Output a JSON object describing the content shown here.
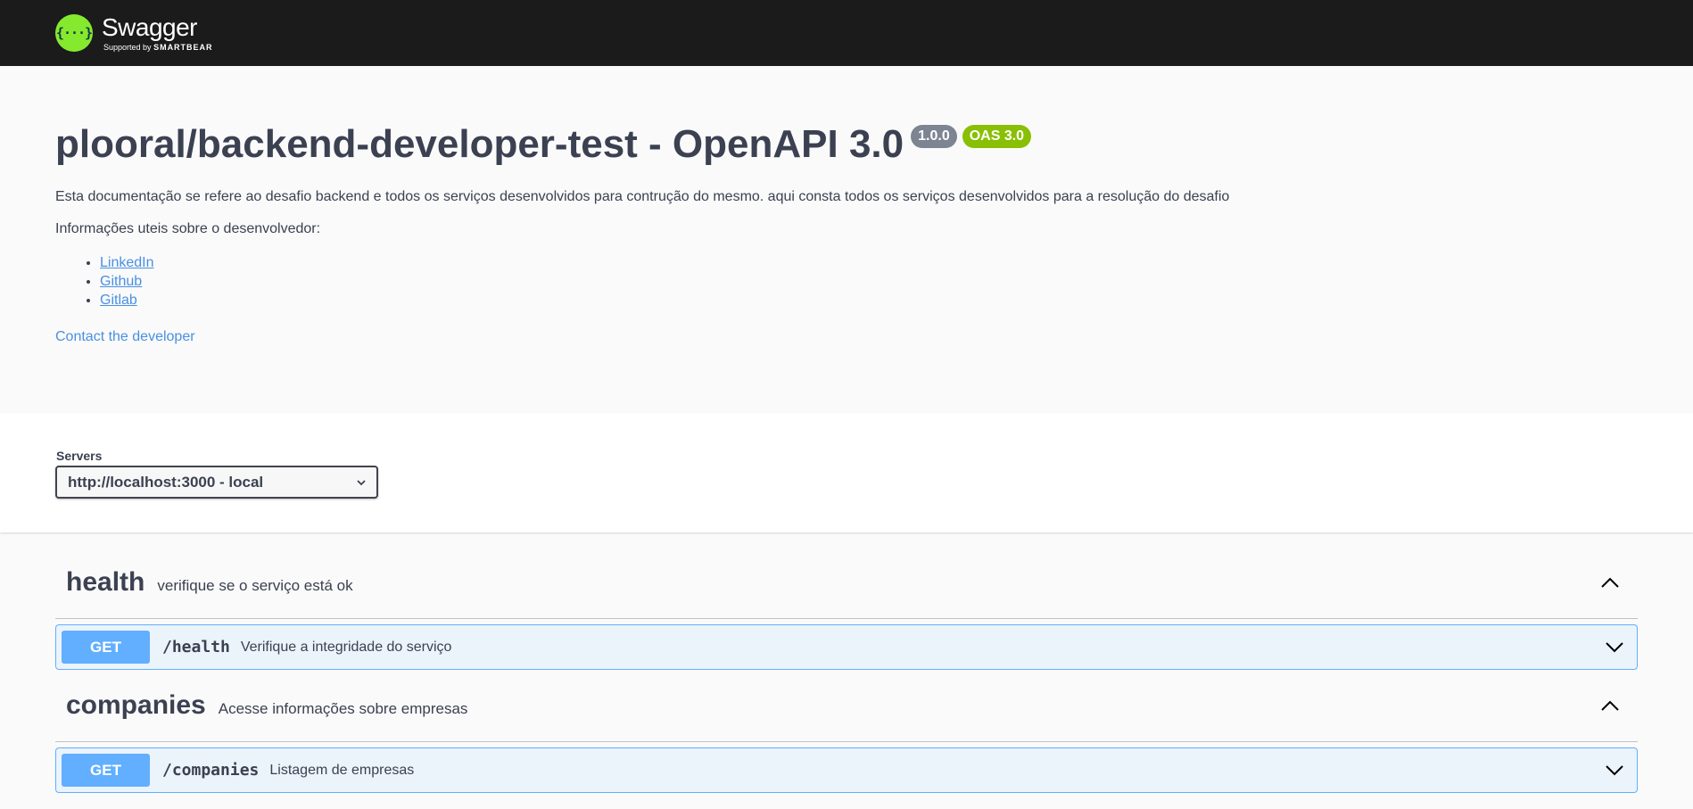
{
  "topbar": {
    "logo_symbol": "{···}",
    "logo_title": "Swagger",
    "logo_sub_prefix": "Supported by",
    "logo_sub_brand": "SMARTBEAR"
  },
  "info": {
    "title": "plooral/backend-developer-test - OpenAPI 3.0",
    "version_badge": "1.0.0",
    "oas_badge": "OAS 3.0",
    "description": "Esta documentação se refere ao desafio backend e todos os serviços desenvolvidos para contrução do mesmo. aqui consta todos os serviços desenvolvidos para a resolução do desafio",
    "dev_info": "Informações uteis sobre o desenvolvedor:",
    "links": [
      "LinkedIn",
      "Github",
      "Gitlab"
    ],
    "contact": "Contact the developer"
  },
  "servers": {
    "label": "Servers",
    "selected": "http://localhost:3000 - local"
  },
  "tags": [
    {
      "name": "health",
      "description": "verifique se o serviço está ok",
      "operations": [
        {
          "method": "GET",
          "path": "/health",
          "summary": "Verifique a integridade do serviço"
        }
      ]
    },
    {
      "name": "companies",
      "description": "Acesse informações sobre empresas",
      "operations": [
        {
          "method": "GET",
          "path": "/companies",
          "summary": "Listagem de empresas"
        }
      ]
    }
  ],
  "colors": {
    "topbar": "#1b1b1b",
    "logo_green": "#85ea2d",
    "get_blue": "#61affe",
    "link_blue": "#4990e2",
    "oas_green": "#89bf04",
    "version_gray": "#7d8492"
  }
}
